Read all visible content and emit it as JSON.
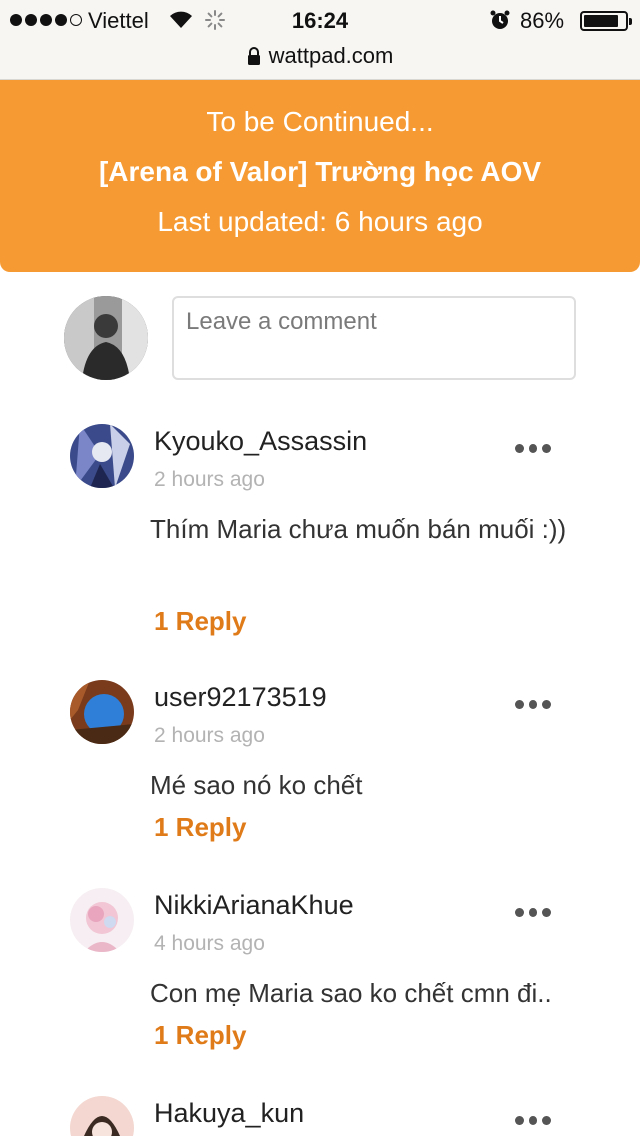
{
  "status_bar": {
    "carrier": "Viettel",
    "time": "16:24",
    "battery": "86%",
    "battery_level": 0.86
  },
  "browser": {
    "url": "wattpad.com"
  },
  "banner": {
    "status": "To be Continued...",
    "story_title": "[Arena of Valor] Trường học AOV",
    "last_updated": "Last updated: 6 hours ago"
  },
  "comment_input": {
    "placeholder": "Leave a comment"
  },
  "comments": [
    {
      "username": "Kyouko_Assassin",
      "time": "2 hours ago",
      "text": "Thím Maria chưa muốn bán muối :))",
      "reply": "1 Reply"
    },
    {
      "username": "user92173519",
      "time": "2 hours ago",
      "text": "Mé sao nó ko chết",
      "reply": "1 Reply"
    },
    {
      "username": "NikkiArianaKhue",
      "time": "4 hours ago",
      "text": "Con mẹ Maria sao ko chết cmn đi..",
      "reply": "1 Reply"
    },
    {
      "username": "Hakuya_kun"
    }
  ],
  "colors": {
    "banner": "#f69b33",
    "reply": "#e07b1a"
  }
}
